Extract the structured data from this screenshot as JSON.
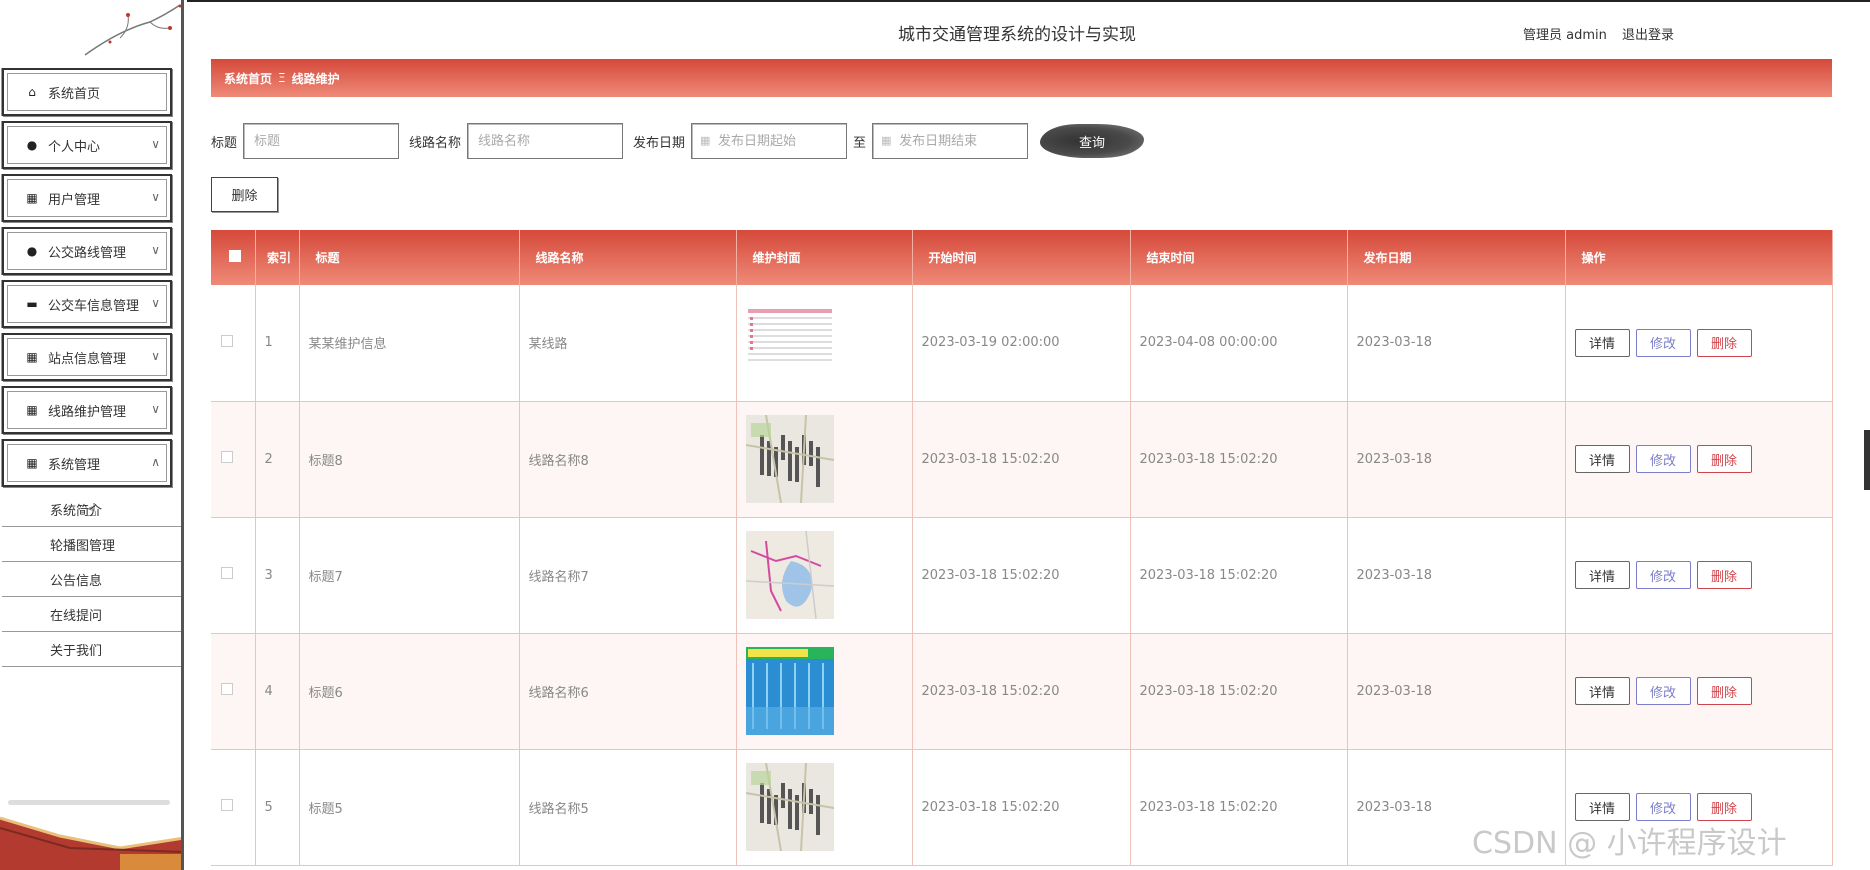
{
  "header": {
    "title": "城市交通管理系统的设计与实现",
    "user": "管理员 admin",
    "logout": "退出登录"
  },
  "sidebar": {
    "items": [
      {
        "label": "系统首页",
        "icon": "home-icon",
        "glyph": "⌂"
      },
      {
        "label": "个人中心",
        "icon": "person-icon",
        "glyph": "●",
        "arrow": "∨"
      },
      {
        "label": "用户管理",
        "icon": "grid-icon",
        "glyph": "▦",
        "arrow": "∨"
      },
      {
        "label": "公交路线管理",
        "icon": "person-icon",
        "glyph": "●",
        "arrow": "∨"
      },
      {
        "label": "公交车信息管理",
        "icon": "chat-icon",
        "glyph": "▬",
        "arrow": "∨"
      },
      {
        "label": "站点信息管理",
        "icon": "grid-icon",
        "glyph": "▦",
        "arrow": "∨"
      },
      {
        "label": "线路维护管理",
        "icon": "grid-icon",
        "glyph": "▦",
        "arrow": "∨"
      },
      {
        "label": "系统管理",
        "icon": "grid-icon",
        "glyph": "▦",
        "arrow": "∧"
      }
    ],
    "submenu": [
      "系统简介",
      "轮播图管理",
      "公告信息",
      "在线提问",
      "关于我们"
    ]
  },
  "breadcrumb": {
    "home": "系统首页",
    "sep": "Ξ",
    "current": "线路维护"
  },
  "search": {
    "title_label": "标题",
    "title_placeholder": "标题",
    "route_label": "线路名称",
    "route_placeholder": "线路名称",
    "date_label": "发布日期",
    "date_start_placeholder": "发布日期起始",
    "to": "至",
    "date_end_placeholder": "发布日期结束",
    "query": "查询"
  },
  "batch_delete": "删除",
  "table": {
    "headers": [
      "",
      "索引",
      "标题",
      "线路名称",
      "维护封面",
      "开始时间",
      "结束时间",
      "发布日期",
      "操作"
    ],
    "rows": [
      {
        "index": "1",
        "title": "某某维护信息",
        "route": "某线路",
        "cover": "table-doc",
        "start": "2023-03-19 02:00:00",
        "end": "2023-04-08 00:00:00",
        "date": "2023-03-18"
      },
      {
        "index": "2",
        "title": "标题8",
        "route": "线路名称8",
        "cover": "map-gray",
        "start": "2023-03-18 15:02:20",
        "end": "2023-03-18 15:02:20",
        "date": "2023-03-18"
      },
      {
        "index": "3",
        "title": "标题7",
        "route": "线路名称7",
        "cover": "map-lake",
        "start": "2023-03-18 15:02:20",
        "end": "2023-03-18 15:02:20",
        "date": "2023-03-18"
      },
      {
        "index": "4",
        "title": "标题6",
        "route": "线路名称6",
        "cover": "blue-board",
        "start": "2023-03-18 15:02:20",
        "end": "2023-03-18 15:02:20",
        "date": "2023-03-18"
      },
      {
        "index": "5",
        "title": "标题5",
        "route": "线路名称5",
        "cover": "map-gray",
        "start": "2023-03-18 15:02:20",
        "end": "2023-03-18 15:02:20",
        "date": "2023-03-18"
      }
    ],
    "actions": {
      "detail": "详情",
      "edit": "修改",
      "delete": "删除"
    }
  },
  "watermark": "CSDN @ 小许程序设计",
  "colors": {
    "accent": "#d5493a",
    "accent_light": "#ef8a78",
    "edit": "#7c7ec8",
    "delete": "#d0444b"
  }
}
